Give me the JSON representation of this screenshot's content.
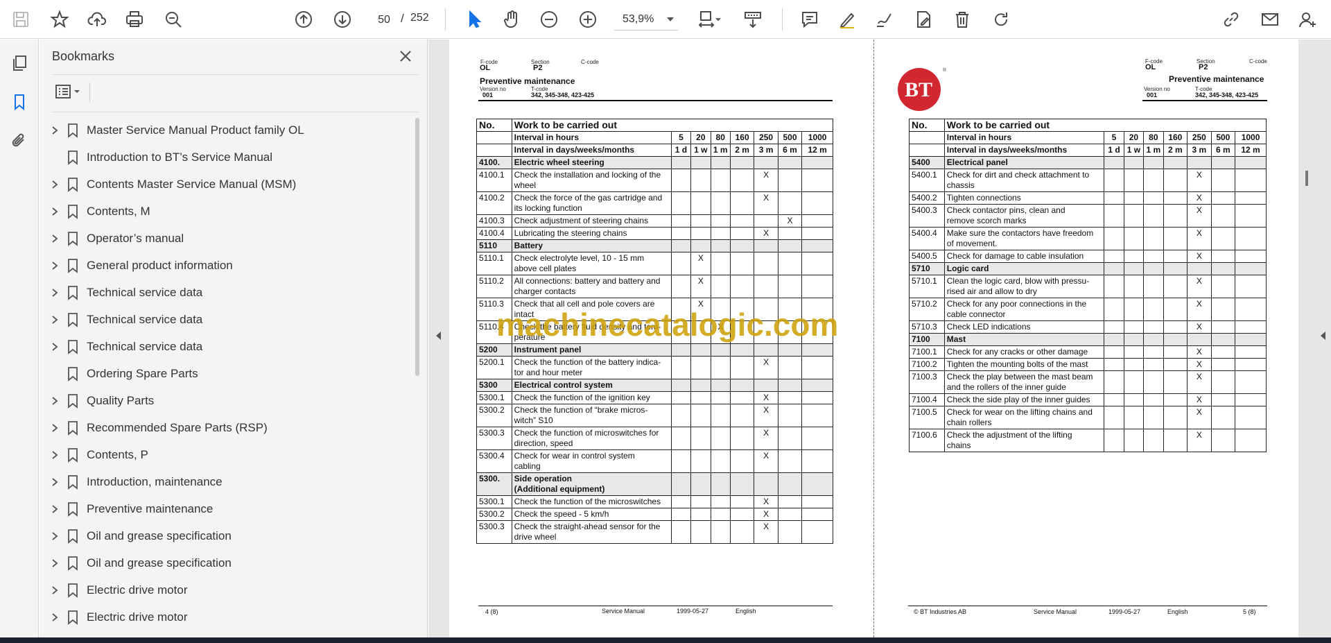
{
  "toolbar": {
    "current_page": "50",
    "page_separator": "/",
    "total_pages": "252",
    "zoom": "53,9%"
  },
  "bookmarks": {
    "title": "Bookmarks",
    "items": [
      {
        "label": "Master Service Manual Product family OL",
        "expandable": true
      },
      {
        "label": "Introduction to BT’s Service Manual",
        "expandable": false
      },
      {
        "label": "Contents Master Service Manual (MSM)",
        "expandable": true
      },
      {
        "label": "Contents, M",
        "expandable": true
      },
      {
        "label": "Operator’s manual",
        "expandable": true
      },
      {
        "label": "General product information",
        "expandable": true
      },
      {
        "label": "Technical service data",
        "expandable": true
      },
      {
        "label": "Technical service data",
        "expandable": true
      },
      {
        "label": "Technical service data",
        "expandable": true
      },
      {
        "label": "Ordering Spare Parts",
        "expandable": false
      },
      {
        "label": "Quality Parts",
        "expandable": true
      },
      {
        "label": "Recommended Spare Parts (RSP)",
        "expandable": true
      },
      {
        "label": "Contents, P",
        "expandable": true
      },
      {
        "label": "Introduction, maintenance",
        "expandable": true
      },
      {
        "label": "Preventive maintenance",
        "expandable": true
      },
      {
        "label": "Oil and grease specification",
        "expandable": true
      },
      {
        "label": "Oil and grease specification",
        "expandable": true
      },
      {
        "label": "Electric drive motor",
        "expandable": true
      },
      {
        "label": "Electric drive motor",
        "expandable": true
      }
    ]
  },
  "doc_header": {
    "fcode_label": "F-code",
    "fcode": "OL",
    "section_label": "Section",
    "section": "P2",
    "ccode_label": "C-code",
    "title": "Preventive maintenance",
    "version_label": "Version no",
    "version": "001",
    "tcode_label": "T-code",
    "tcode": "342, 345-348, 423-425"
  },
  "table_header": {
    "no": "No.",
    "work": "Work to be carried out",
    "interval_hours": "Interval in hours",
    "hours": [
      "5",
      "20",
      "80",
      "160",
      "250",
      "500",
      "1000"
    ],
    "interval_days": "Interval in days/weeks/months",
    "days": [
      "1 d",
      "1 w",
      "1 m",
      "2 m",
      "3 m",
      "6 m",
      "12 m"
    ]
  },
  "left_rows": [
    {
      "sec": true,
      "no": "4100.",
      "text": "Electric wheel steering"
    },
    {
      "no": "4100.1",
      "text": "Check the installation and locking of the",
      "text2": "wheel",
      "x": 4
    },
    {
      "no": "4100.2",
      "text": "Check the force of the gas cartridge and",
      "text2": "its locking function",
      "x": 4
    },
    {
      "no": "4100.3",
      "text": "Check adjustment of steering chains",
      "x": 5
    },
    {
      "no": "4100.4",
      "text": "Lubricating the steering chains",
      "x": 4
    },
    {
      "sec": true,
      "no": "5110",
      "text": "Battery"
    },
    {
      "no": "5110.1",
      "text": "Check electrolyte level, 10 - 15 mm",
      "text2": "above cell plates",
      "x": 1
    },
    {
      "no": "5110.2",
      "text": "All connections: battery and battery and",
      "text2": "charger contacts",
      "x": 1
    },
    {
      "no": "5110.3",
      "text": "Check that all cell and pole covers are",
      "text2": "intact",
      "x": 1
    },
    {
      "no": "5110.4",
      "text": "Check the battery fluid density and tem-",
      "text2": "perature",
      "x": 2
    },
    {
      "sec": true,
      "no": "5200",
      "text": "Instrument panel"
    },
    {
      "no": "5200.1",
      "text": "Check the function of the battery indica-",
      "text2": "tor and hour meter",
      "x": 4
    },
    {
      "sec": true,
      "no": "5300",
      "text": "Electrical control system"
    },
    {
      "no": "5300.1",
      "text": "Check the function of the ignition key",
      "x": 4
    },
    {
      "no": "5300.2",
      "text": "Check the function of “brake micros-",
      "text2": "witch” S10",
      "x": 4
    },
    {
      "no": "5300.3",
      "text": "Check the function of microswitches for",
      "text2": "direction, speed",
      "x": 4
    },
    {
      "no": "5300.4",
      "text": "Check for wear in control system",
      "text2": "cabling",
      "x": 4
    },
    {
      "sec": true,
      "no": "5300.",
      "text": "Side operation",
      "text2": "(Additional equipment)"
    },
    {
      "no": "5300.1",
      "text": "Check the function of the microswitches",
      "x": 4
    },
    {
      "no": "5300.2",
      "text": "Check the speed - 5 km/h",
      "x": 4
    },
    {
      "no": "5300.3",
      "text": "Check the straight-ahead sensor for the",
      "text2": "drive wheel",
      "x": 4
    }
  ],
  "right_rows": [
    {
      "sec": true,
      "no": "5400",
      "text": "Electrical panel"
    },
    {
      "no": "5400.1",
      "text": "Check for dirt and check attachment to",
      "text2": "chassis",
      "x": 4
    },
    {
      "no": "5400.2",
      "text": "Tighten connections",
      "x": 4
    },
    {
      "no": "5400.3",
      "text": "Check contactor pins, clean and",
      "text2": "remove scorch marks",
      "x": 4
    },
    {
      "no": "5400.4",
      "text": "Make sure the contactors have freedom",
      "text2": "of movement.",
      "x": 4
    },
    {
      "no": "5400.5",
      "text": "Check for damage to cable insulation",
      "x": 4
    },
    {
      "sec": true,
      "no": "5710",
      "text": "Logic card"
    },
    {
      "no": "5710.1",
      "text": "Clean the logic card, blow with pressu-",
      "text2": "rised air and allow to dry",
      "x": 4
    },
    {
      "no": "5710.2",
      "text": "Check for any poor connections in the",
      "text2": "cable connector",
      "x": 4
    },
    {
      "no": "5710.3",
      "text": "Check LED indications",
      "x": 4
    },
    {
      "sec": true,
      "no": "7100",
      "text": "Mast"
    },
    {
      "no": "7100.1",
      "text": "Check for any cracks or other damage",
      "x": 4
    },
    {
      "no": "7100.2",
      "text": "Tighten the mounting bolts of the mast",
      "x": 4
    },
    {
      "no": "7100.3",
      "text": "Check the play between the mast beam",
      "text2": "and the rollers of the inner guide",
      "x": 4
    },
    {
      "no": "7100.4",
      "text": "Check the side play of the inner guides",
      "x": 4
    },
    {
      "no": "7100.5",
      "text": "Check for wear on the lifting chains and",
      "text2": "chain rollers",
      "x": 4
    },
    {
      "no": "7100.6",
      "text": "Check the adjustment of the lifting",
      "text2": "chains",
      "x": 4
    }
  ],
  "x_mark": "X",
  "left_footer": {
    "page": "4 (8)",
    "doc": "Service Manual",
    "date": "1999-05-27",
    "lang": "English"
  },
  "right_footer": {
    "copyright": "© BT Industries AB",
    "doc": "Service Manual",
    "date": "1999-05-27",
    "lang": "English",
    "page": "5 (8)"
  },
  "watermark": "machinecatalogic.com",
  "logo": {
    "text": "BT",
    "reg": "®",
    "color": "#d22630"
  }
}
